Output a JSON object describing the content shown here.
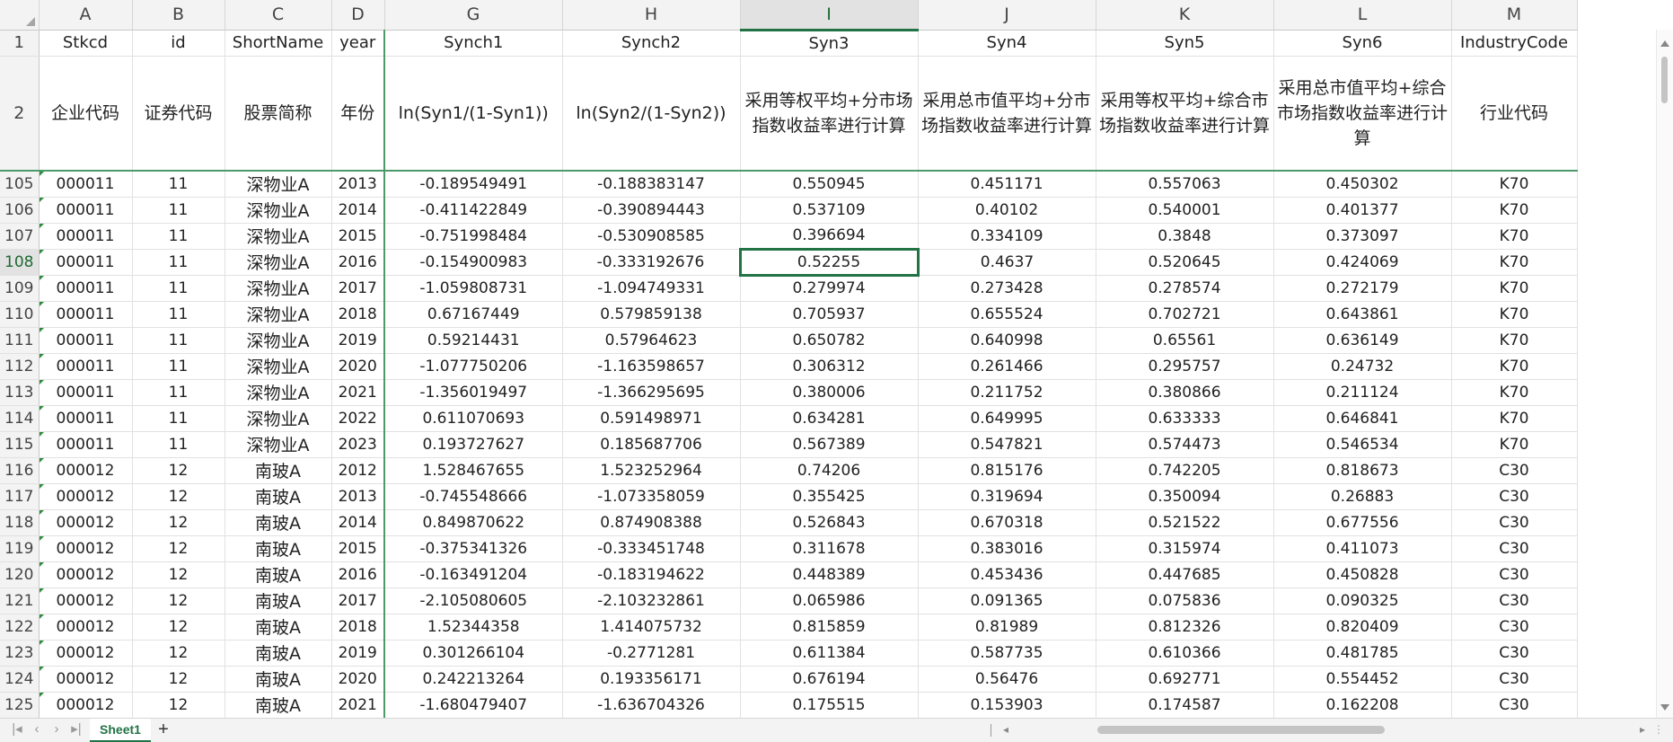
{
  "columns": [
    "A",
    "B",
    "C",
    "D",
    "G",
    "H",
    "I",
    "J",
    "K",
    "L",
    "M"
  ],
  "selected_column": "I",
  "header_row": {
    "num": "1",
    "cells": [
      "Stkcd",
      "id",
      "ShortName",
      "year",
      "Synch1",
      "Synch2",
      "Syn3",
      "Syn4",
      "Syn5",
      "Syn6",
      "IndustryCode"
    ]
  },
  "label_row": {
    "num": "2",
    "cells": [
      "企业代码",
      "证券代码",
      "股票简称",
      "年份",
      "ln(Syn1/(1-Syn1))",
      "ln(Syn2/(1-Syn2))",
      "采用等权平均+分市场指数收益率进行计算",
      "采用总市值平均+分市场指数收益率进行计算",
      "采用等权平均+综合市场指数收益率进行计算",
      "采用总市值平均+综合市场指数收益率进行计算",
      "行业代码"
    ]
  },
  "rows": [
    {
      "num": "105",
      "cells": [
        "000011",
        "11",
        "深物业A",
        "2013",
        "-0.189549491",
        "-0.188383147",
        "0.550945",
        "0.451171",
        "0.557063",
        "0.450302",
        "K70"
      ]
    },
    {
      "num": "106",
      "cells": [
        "000011",
        "11",
        "深物业A",
        "2014",
        "-0.411422849",
        "-0.390894443",
        "0.537109",
        "0.40102",
        "0.540001",
        "0.401377",
        "K70"
      ]
    },
    {
      "num": "107",
      "cells": [
        "000011",
        "11",
        "深物业A",
        "2015",
        "-0.751998484",
        "-0.530908585",
        "0.396694",
        "0.334109",
        "0.3848",
        "0.373097",
        "K70"
      ]
    },
    {
      "num": "108",
      "cells": [
        "000011",
        "11",
        "深物业A",
        "2016",
        "-0.154900983",
        "-0.333192676",
        "0.52255",
        "0.4637",
        "0.520645",
        "0.424069",
        "K70"
      ]
    },
    {
      "num": "109",
      "cells": [
        "000011",
        "11",
        "深物业A",
        "2017",
        "-1.059808731",
        "-1.094749331",
        "0.279974",
        "0.273428",
        "0.278574",
        "0.272179",
        "K70"
      ]
    },
    {
      "num": "110",
      "cells": [
        "000011",
        "11",
        "深物业A",
        "2018",
        "0.67167449",
        "0.579859138",
        "0.705937",
        "0.655524",
        "0.702721",
        "0.643861",
        "K70"
      ]
    },
    {
      "num": "111",
      "cells": [
        "000011",
        "11",
        "深物业A",
        "2019",
        "0.59214431",
        "0.57964623",
        "0.650782",
        "0.640998",
        "0.65561",
        "0.636149",
        "K70"
      ]
    },
    {
      "num": "112",
      "cells": [
        "000011",
        "11",
        "深物业A",
        "2020",
        "-1.077750206",
        "-1.163598657",
        "0.306312",
        "0.261466",
        "0.295757",
        "0.24732",
        "K70"
      ]
    },
    {
      "num": "113",
      "cells": [
        "000011",
        "11",
        "深物业A",
        "2021",
        "-1.356019497",
        "-1.366295695",
        "0.380006",
        "0.211752",
        "0.380866",
        "0.211124",
        "K70"
      ]
    },
    {
      "num": "114",
      "cells": [
        "000011",
        "11",
        "深物业A",
        "2022",
        "0.611070693",
        "0.591498971",
        "0.634281",
        "0.649995",
        "0.633333",
        "0.646841",
        "K70"
      ]
    },
    {
      "num": "115",
      "cells": [
        "000011",
        "11",
        "深物业A",
        "2023",
        "0.193727627",
        "0.185687706",
        "0.567389",
        "0.547821",
        "0.574473",
        "0.546534",
        "K70"
      ]
    },
    {
      "num": "116",
      "cells": [
        "000012",
        "12",
        "南玻A",
        "2012",
        "1.528467655",
        "1.523252964",
        "0.74206",
        "0.815176",
        "0.742205",
        "0.818673",
        "C30"
      ]
    },
    {
      "num": "117",
      "cells": [
        "000012",
        "12",
        "南玻A",
        "2013",
        "-0.745548666",
        "-1.073358059",
        "0.355425",
        "0.319694",
        "0.350094",
        "0.26883",
        "C30"
      ]
    },
    {
      "num": "118",
      "cells": [
        "000012",
        "12",
        "南玻A",
        "2014",
        "0.849870622",
        "0.874908388",
        "0.526843",
        "0.670318",
        "0.521522",
        "0.677556",
        "C30"
      ]
    },
    {
      "num": "119",
      "cells": [
        "000012",
        "12",
        "南玻A",
        "2015",
        "-0.375341326",
        "-0.333451748",
        "0.311678",
        "0.383016",
        "0.315974",
        "0.411073",
        "C30"
      ]
    },
    {
      "num": "120",
      "cells": [
        "000012",
        "12",
        "南玻A",
        "2016",
        "-0.163491204",
        "-0.183194622",
        "0.448389",
        "0.453436",
        "0.447685",
        "0.450828",
        "C30"
      ]
    },
    {
      "num": "121",
      "cells": [
        "000012",
        "12",
        "南玻A",
        "2017",
        "-2.105080605",
        "-2.103232861",
        "0.065986",
        "0.091365",
        "0.075836",
        "0.090325",
        "C30"
      ]
    },
    {
      "num": "122",
      "cells": [
        "000012",
        "12",
        "南玻A",
        "2018",
        "1.52344358",
        "1.414075732",
        "0.815859",
        "0.81989",
        "0.812326",
        "0.820409",
        "C30"
      ]
    },
    {
      "num": "123",
      "cells": [
        "000012",
        "12",
        "南玻A",
        "2019",
        "0.301266104",
        "-0.2771281",
        "0.611384",
        "0.587735",
        "0.610366",
        "0.481785",
        "C30"
      ]
    },
    {
      "num": "124",
      "cells": [
        "000012",
        "12",
        "南玻A",
        "2020",
        "0.242213264",
        "0.193356171",
        "0.676194",
        "0.56476",
        "0.692771",
        "0.554452",
        "C30"
      ]
    },
    {
      "num": "125",
      "cells": [
        "000012",
        "12",
        "南玻A",
        "2021",
        "-1.680479407",
        "-1.636704326",
        "0.175515",
        "0.153903",
        "0.174587",
        "0.162208",
        "C30"
      ]
    }
  ],
  "active_cell": {
    "row": "108",
    "column": "I",
    "value": "0.52255"
  },
  "sheet_tab": "Sheet1",
  "add_sheet_symbol": "+",
  "accent_color": "#217346"
}
